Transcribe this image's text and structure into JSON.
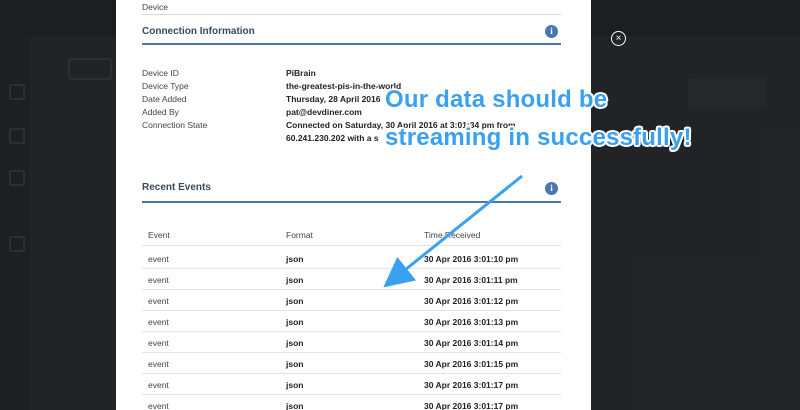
{
  "header": {
    "section_prev_label": "Device"
  },
  "connection": {
    "title": "Connection Information",
    "info_glyph": "i",
    "fields": [
      {
        "label": "Device ID",
        "value": "PiBrain"
      },
      {
        "label": "Device Type",
        "value": "the-greatest-pis-in-the-world"
      },
      {
        "label": "Date Added",
        "value": "Thursday, 28 April 2016"
      },
      {
        "label": "Added By",
        "value": "pat@devdiner.com"
      },
      {
        "label": "Connection State",
        "value": "Connected on Saturday, 30 April 2016 at 3:01:34 pm from"
      }
    ],
    "state_line2": "60.241.230.202 with a s"
  },
  "events": {
    "title": "Recent Events",
    "info_glyph": "i",
    "columns": [
      "Event",
      "Format",
      "Time Received"
    ],
    "rows": [
      {
        "event": "event",
        "format": "json",
        "time": "30 Apr 2016 3:01:10 pm"
      },
      {
        "event": "event",
        "format": "json",
        "time": "30 Apr 2016 3:01:11 pm"
      },
      {
        "event": "event",
        "format": "json",
        "time": "30 Apr 2016 3:01:12 pm"
      },
      {
        "event": "event",
        "format": "json",
        "time": "30 Apr 2016 3:01:13 pm"
      },
      {
        "event": "event",
        "format": "json",
        "time": "30 Apr 2016 3:01:14 pm"
      },
      {
        "event": "event",
        "format": "json",
        "time": "30 Apr 2016 3:01:15 pm"
      },
      {
        "event": "event",
        "format": "json",
        "time": "30 Apr 2016 3:01:17 pm"
      },
      {
        "event": "event",
        "format": "json",
        "time": "30 Apr 2016 3:01:17 pm"
      }
    ]
  },
  "annotation": {
    "line1": "Our data should be",
    "line2": "streaming in successfully!"
  },
  "close_glyph": "×",
  "colors": {
    "accent": "#4a77b4",
    "annotation": "#3aa0f0",
    "overlay_bg": "#35373b"
  }
}
